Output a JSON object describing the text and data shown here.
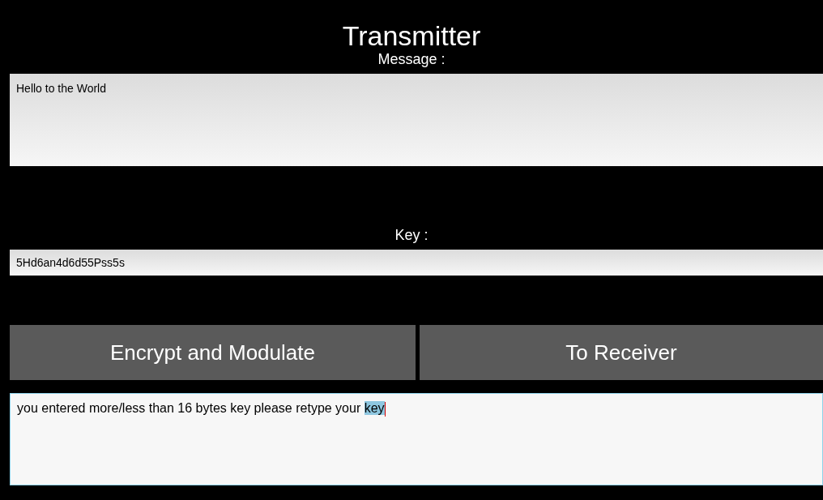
{
  "title": "Transmitter",
  "message": {
    "label": "Message :",
    "value": "Hello to the World"
  },
  "key": {
    "label": "Key :",
    "value": "5Hd6an4d6d55Pss5s"
  },
  "buttons": [
    "Encrypt and Modulate",
    "To Receiver"
  ],
  "output": {
    "value": "you entered more/less than 16 bytes key please retype your ",
    "selected_text": "key",
    "focused": true
  }
}
